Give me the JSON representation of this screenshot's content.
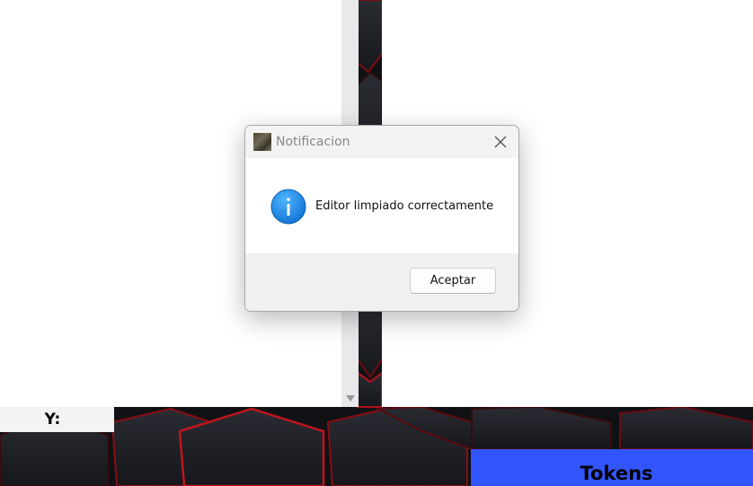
{
  "dialog": {
    "title": "Notificacion",
    "message": "Editor limpiado correctamente",
    "ok_label": "Aceptar"
  },
  "status": {
    "y_label": "Y:"
  },
  "tokens": {
    "label": "Tokens"
  },
  "colors": {
    "tokens_bar": "#3355ff",
    "info_blue": "#1a8ae6",
    "background_dark": "#15161a",
    "hex_glow_red": "#c0141c"
  }
}
